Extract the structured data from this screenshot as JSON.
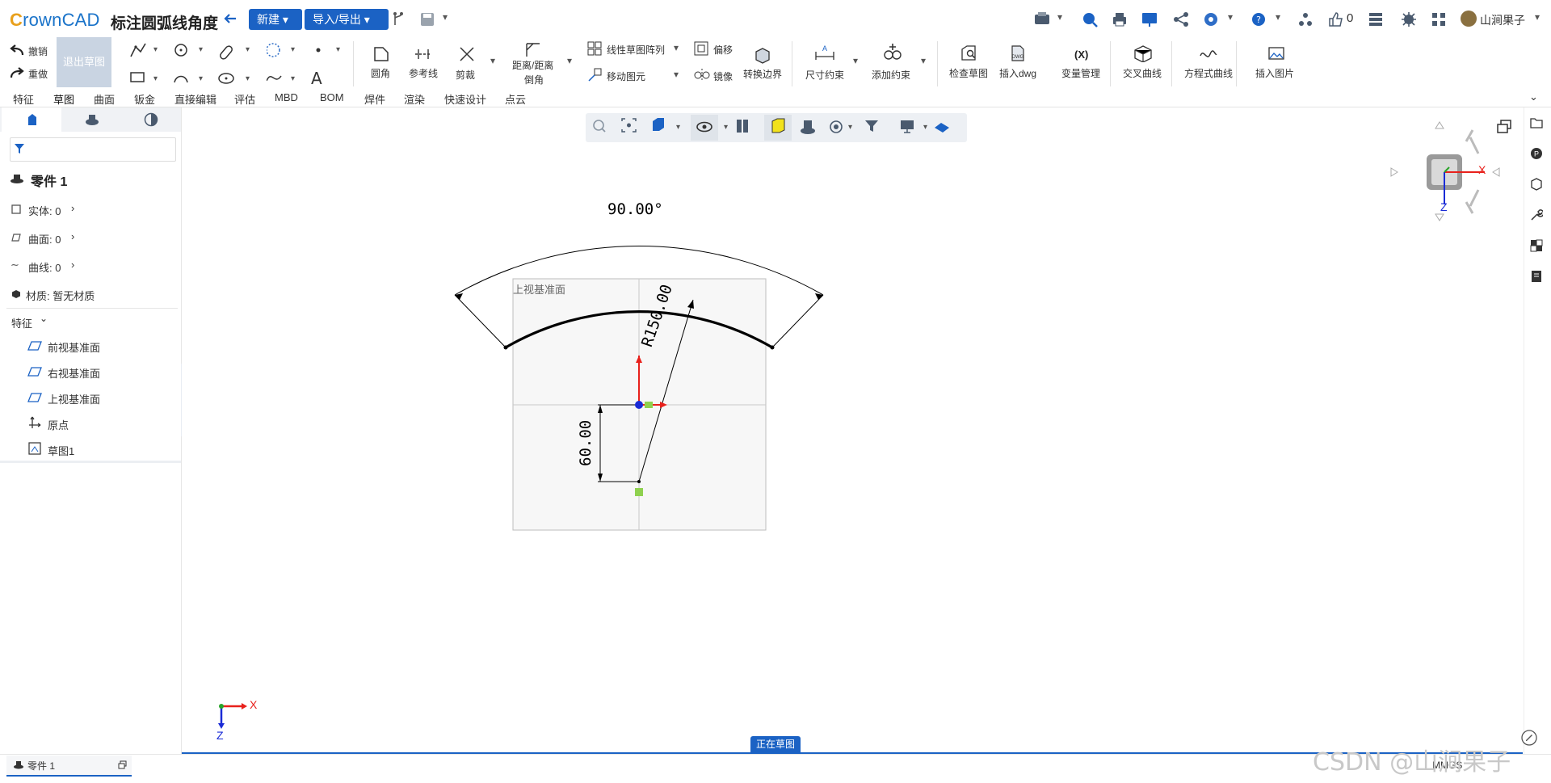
{
  "app": {
    "logo": "CrownCAD",
    "doc_title": "标注圆弧线角度"
  },
  "topbar": {
    "new_label": "新建",
    "io_label": "导入/导出",
    "likes": "0",
    "user": "山涧果子",
    "icons": [
      "back-icon",
      "branch-icon",
      "save-icon",
      "print-preview-icon",
      "search-icon",
      "print-icon",
      "present-icon",
      "share-icon",
      "settings-icon",
      "help-icon",
      "tree-icon",
      "like-icon",
      "layers-icon",
      "bug-icon",
      "network-icon"
    ]
  },
  "ribbon": {
    "undo": "撤销",
    "redo": "重做",
    "exit_sketch": "退出草图",
    "fillet": "圆角",
    "reference_line": "参考线",
    "trim": "剪裁",
    "distance_chamfer_1": "距离/距离",
    "distance_chamfer_2": "倒角",
    "linear_pattern": "线性草图阵列",
    "move_entity": "移动图元",
    "offset": "偏移",
    "mirror": "镜像",
    "convert_edge": "转换边界",
    "dimension": "尺寸约束",
    "add_constraint": "添加约束",
    "check_sketch": "检查草图",
    "insert_dwg": "插入dwg",
    "variable_mgr": "变量管理",
    "variable_icon_text": "(X)",
    "intersection_curve": "交叉曲线",
    "equation_curve": "方程式曲线",
    "insert_image": "插入图片"
  },
  "tabs": [
    "特征",
    "草图",
    "曲面",
    "钣金",
    "直接编辑",
    "评估",
    "MBD",
    "BOM",
    "焊件",
    "渲染",
    "快速设计",
    "点云"
  ],
  "active_tab": "草图",
  "tree": {
    "part": "零件 1",
    "solid": "实体: 0",
    "surface": "曲面: 0",
    "curve": "曲线: 0",
    "material": "材质: 暂无材质",
    "features_header": "特征",
    "items": [
      "前视基准面",
      "右视基准面",
      "上视基准面",
      "原点",
      "草图1"
    ]
  },
  "sketch": {
    "plane_label": "上视基准面",
    "angle_dim": "90.00°",
    "radius_dim": "R150.00",
    "vertical_dim": "60.00"
  },
  "triad": {
    "x": "X",
    "z": "Z"
  },
  "status": {
    "editing": "正在草图",
    "units": "MMGS",
    "part_tab": "零件 1"
  },
  "watermark": "CSDN @山涧果子",
  "colors": {
    "accent": "#1b62c4",
    "axis_x": "#e8211c",
    "axis_z": "#1a2bd6",
    "axis_y": "#2aa52a"
  }
}
